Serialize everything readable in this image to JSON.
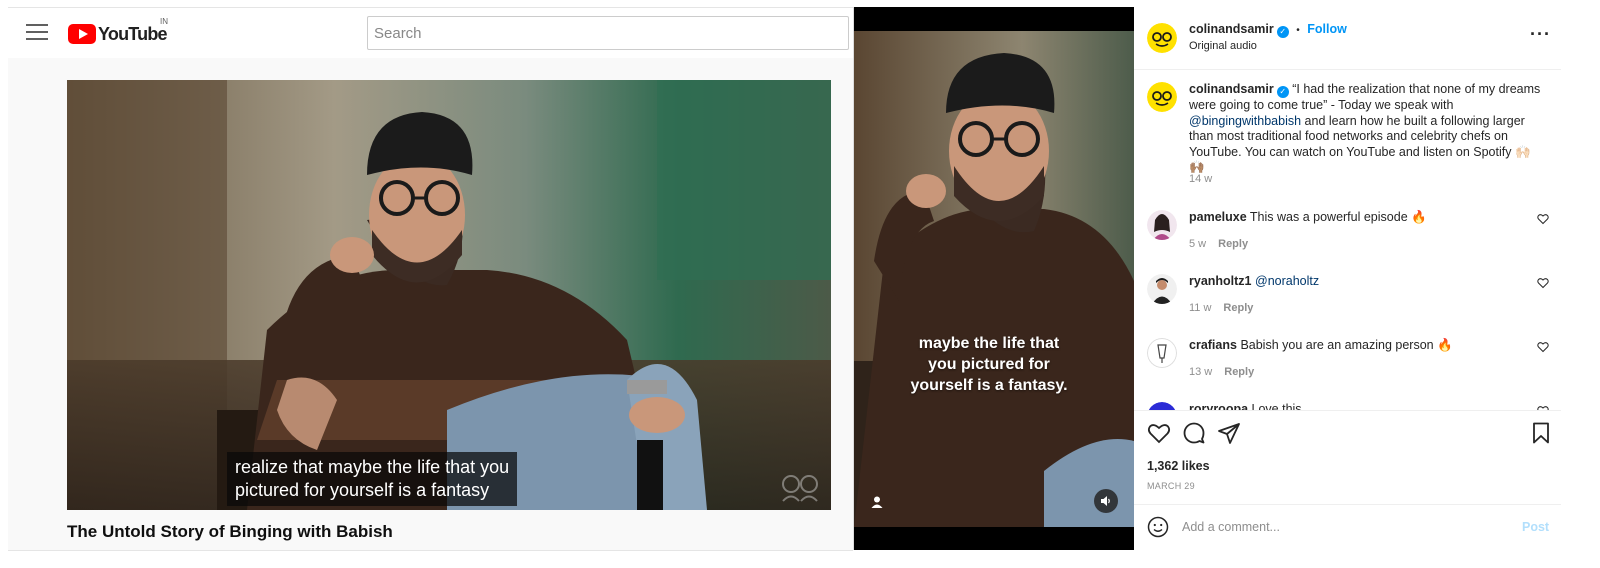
{
  "youtube": {
    "logo_text": "YouTube",
    "logo_country": "IN",
    "search_placeholder": "Search",
    "player_caption_line1": "realize that maybe the life that you",
    "player_caption_line2": "pictured for yourself is a fantasy",
    "video_title": "The Untold Story of Binging with Babish"
  },
  "instagram": {
    "header": {
      "username": "colinandsamir",
      "separator": "•",
      "follow_label": "Follow",
      "subtitle": "Original audio"
    },
    "video_caption_line1": "maybe the life that",
    "video_caption_line2": "you pictured for",
    "video_caption_line3": "yourself is a fantasy.",
    "post_caption": {
      "username": "colinandsamir",
      "text_part1": "“I had the realization that none of my dreams were going to come true” - Today we speak with ",
      "mention": "@bingingwithbabish",
      "text_part2": " and learn how he built a following larger than most traditional food networks and celebrity chefs on YouTube. You can watch on YouTube and listen on Spotify 🙌🏻🙌🏽",
      "age": "14 w"
    },
    "comments": [
      {
        "username": "pameluxe",
        "text": "This was a powerful episode 🔥",
        "age": "5 w",
        "reply_label": "Reply"
      },
      {
        "username": "ryanholtz1",
        "text": "@noraholtz",
        "age": "11 w",
        "reply_label": "Reply"
      },
      {
        "username": "crafians",
        "text": "Babish you are an amazing person 🔥",
        "age": "13 w",
        "reply_label": "Reply"
      },
      {
        "username": "roryroopa",
        "text": "Love this",
        "age": "",
        "reply_label": ""
      }
    ],
    "likes": "1,362 likes",
    "date": "MARCH 29",
    "comment_placeholder": "Add a comment...",
    "post_label": "Post",
    "colors": {
      "accent": "#0095f6",
      "post_disabled": "#b2dffc",
      "mention": "#00376b",
      "yt_red": "#ff0000"
    }
  }
}
